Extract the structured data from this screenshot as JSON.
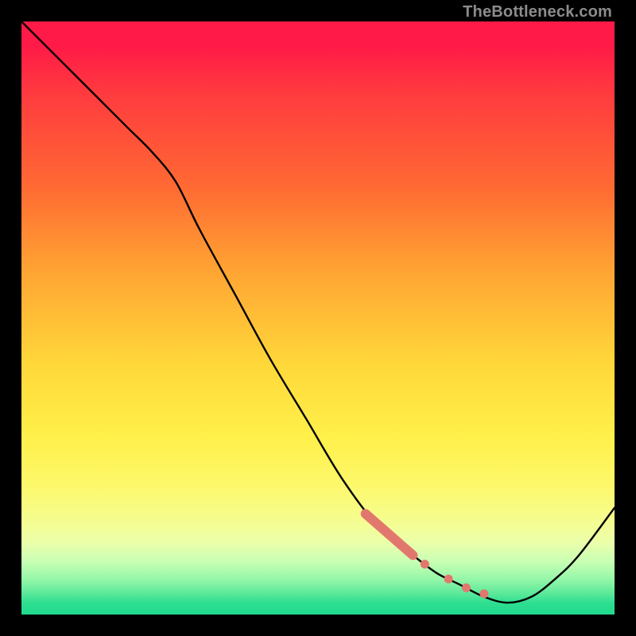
{
  "watermark": "TheBottleneck.com",
  "colors": {
    "background": "#000000",
    "gradient_top": "#ff1a47",
    "gradient_mid": "#ffe23a",
    "gradient_bottom": "#1fd98c",
    "curve": "#000000",
    "marker": "#e2786d"
  },
  "chart_data": {
    "type": "line",
    "title": "",
    "xlabel": "",
    "ylabel": "",
    "xlim": [
      0,
      100
    ],
    "ylim": [
      0,
      100
    ],
    "grid": false,
    "series": [
      {
        "name": "bottleneck-curve",
        "x": [
          0,
          6,
          12,
          18,
          22,
          26,
          30,
          36,
          42,
          48,
          54,
          60,
          66,
          70,
          74,
          78,
          82,
          86,
          90,
          94,
          100
        ],
        "y": [
          100,
          94,
          88,
          82,
          78,
          73,
          65,
          54,
          43,
          33,
          23,
          15,
          10,
          7,
          5,
          3,
          2,
          3,
          6,
          10,
          18
        ]
      }
    ],
    "markers": [
      {
        "name": "highlight-segment",
        "shape": "thick-line",
        "color": "#e2786d",
        "x": [
          58,
          66
        ],
        "y": [
          17,
          10
        ]
      },
      {
        "name": "highlight-dots",
        "shape": "dots",
        "color": "#e2786d",
        "points": [
          {
            "x": 68,
            "y": 8.5
          },
          {
            "x": 72,
            "y": 6
          },
          {
            "x": 75,
            "y": 4.5
          },
          {
            "x": 78,
            "y": 3.5
          }
        ]
      }
    ],
    "legend": false,
    "annotations": []
  }
}
